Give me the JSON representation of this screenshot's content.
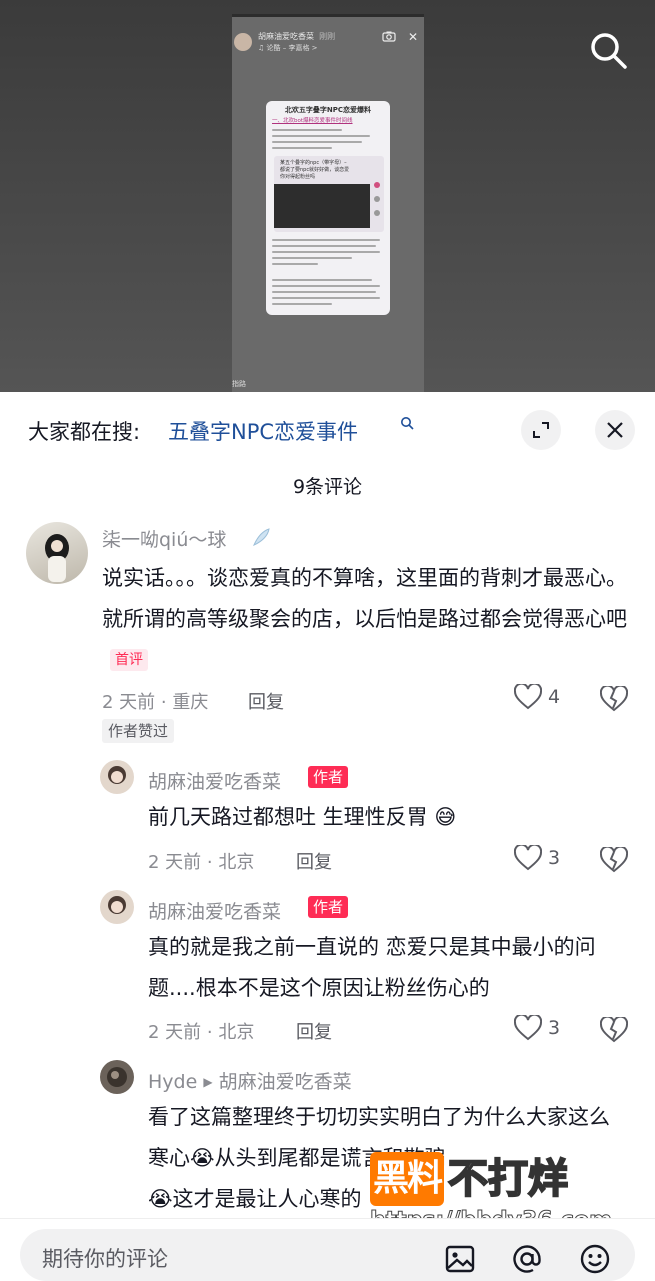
{
  "video": {
    "author_name": "胡麻油爱吃香菜",
    "time": "刚刚",
    "music": "♫ 论酷 – 李嘉格 >",
    "card_title": "北欢五字叠字NPC恋爱爆料",
    "card_subtitle": "一、北欢bot爆料恋爱事件时间线",
    "card_box_text": "某五个叠字的npc（带字母）– 都说了要npc就好好做，谈恋爱你对得起粉丝吗",
    "footer": "指路"
  },
  "search": {
    "prefix": "大家都在搜:",
    "query": "五叠字NPC恋爱事件"
  },
  "comments_title": "9条评论",
  "comments": [
    {
      "user": "柒一呦qiú～球",
      "text": "说实话。。。谈恋爱真的不算啥，这里面的背刺才最恶心。就所谓的高等级聚会的店，以后怕是路过都会觉得恶心吧",
      "first_tag": "首评",
      "meta": "2 天前 · 重庆",
      "reply": "回复",
      "likes": "4",
      "liked_by_author": "作者赞过"
    },
    {
      "user": "胡麻油爱吃香菜",
      "badge": "作者",
      "text": "前几天路过都想吐 生理性反胃",
      "meta": "2 天前 · 北京",
      "reply": "回复",
      "likes": "3"
    },
    {
      "user": "胡麻油爱吃香菜",
      "badge": "作者",
      "text": "真的就是我之前一直说的 恋爱只是其中最小的问题....根本不是这个原因让粉丝伤心的",
      "meta": "2 天前 · 北京",
      "reply": "回复",
      "likes": "3"
    },
    {
      "user": "Hyde",
      "reply_to": "胡麻油爱吃香菜",
      "text_1": "看了这篇整理终于切切实实明白了为什么大家这么寒心",
      "text_2": "从头到尾都是谎言和欺骗",
      "text_3": "这才是最让人心寒的"
    }
  ],
  "watermark": {
    "box": "黑料",
    "text": "不打烊",
    "url": "https://bbdy36.com"
  },
  "input": {
    "placeholder": "期待你的评论"
  },
  "colors": {
    "accent": "#fe2c55",
    "link": "#1f4f99",
    "watermark": "#ff7a00"
  }
}
